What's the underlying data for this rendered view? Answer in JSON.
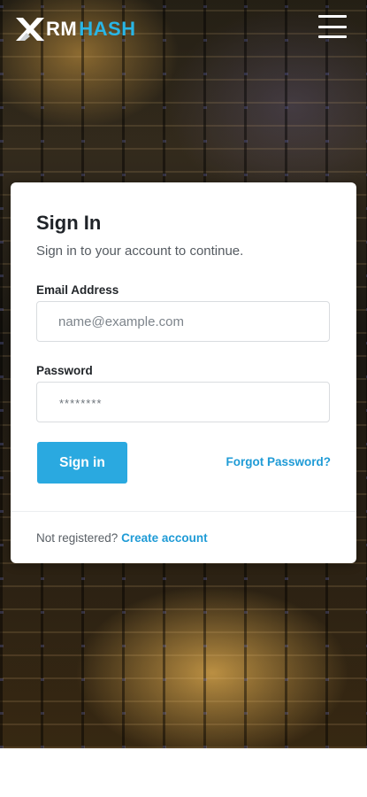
{
  "header": {
    "logo_part1": "RM",
    "logo_part2": "HASH",
    "menu_icon": "hamburger-menu-icon"
  },
  "colors": {
    "accent": "#2aa9e0",
    "link": "#1f9bd6",
    "logo_accent": "#29b6e6"
  },
  "signin": {
    "title": "Sign In",
    "subtitle": "Sign in to your account to continue.",
    "email_label": "Email Address",
    "email_placeholder": "name@example.com",
    "password_label": "Password",
    "password_value": "********",
    "submit_label": "Sign in",
    "forgot_label": "Forgot Password?",
    "footer_text": "Not registered?",
    "create_account_label": "Create account"
  }
}
